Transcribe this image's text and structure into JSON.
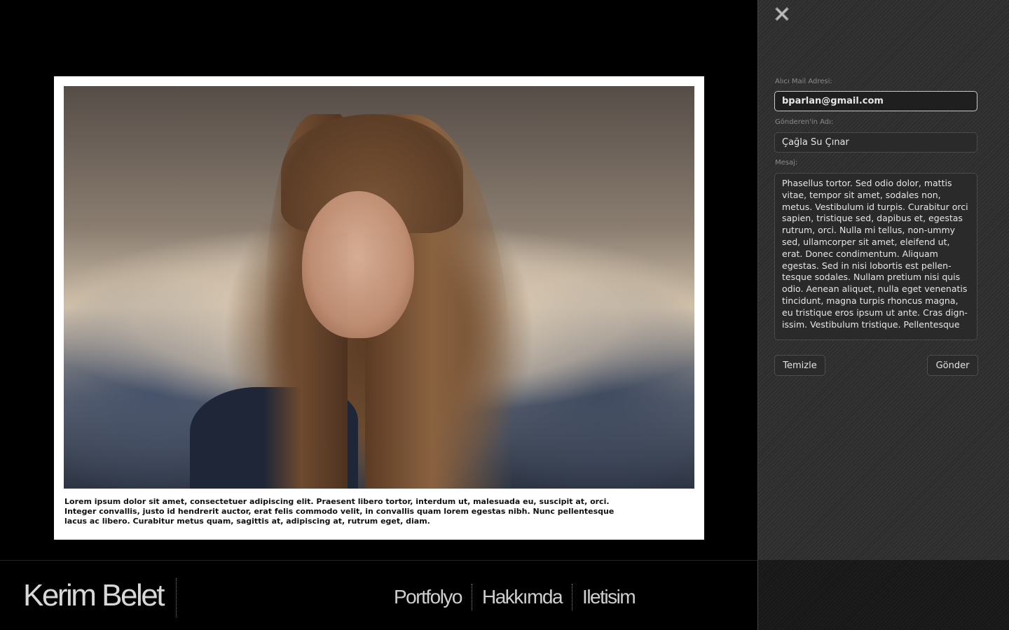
{
  "photo": {
    "caption": "Lorem ipsum dolor sit amet, consectetuer adipiscing elit. Praesent libero tortor, interdum ut, malesuada eu, suscipit at, orci. Integer convallis, justo id hendrerit auctor, erat felis commodo velit, in convallis quam lorem egestas nibh. Nunc pellentesque lacus ac libero. Curabitur metus quam, sagittis at, adipiscing at, rutrum eget, diam."
  },
  "footer": {
    "brand": "Kerim Belet",
    "nav": [
      "Portfolyo",
      "Hakkımda",
      "Iletisim"
    ]
  },
  "contact_form": {
    "close_icon": "close-x-icon",
    "recipient_label": "Alıcı Mail Adresi:",
    "recipient_value": "bparlan@gmail.com",
    "sender_label": "Gönderen'in Adı:",
    "sender_value": "Çağla Su Çınar",
    "message_label": "Mesaj:",
    "message_value": "Phasellus tortor. Sed odio dolor, mattis vitae, tempor sit amet, sodales non, metus. Vestibulum id turpis. Curabitur orci sapien, tristique sed, dapibus et, egestas rutrum, orci. Nulla mi tellus, non-ummy sed, ullamcorper sit amet, eleifend ut, erat. Donec condimentum. Aliquam egestas. Sed in nisi lobortis est pellen-tesque sodales. Nullam pretium nisi quis odio. Aenean aliquet, nulla eget venenatis tincidunt, magna turpis rhoncus magna, eu tristique eros ipsum ut ante. Cras dign-issim. Vestibulum tristique. Pellentesque",
    "clear_button": "Temizle",
    "send_button": "Gönder"
  }
}
